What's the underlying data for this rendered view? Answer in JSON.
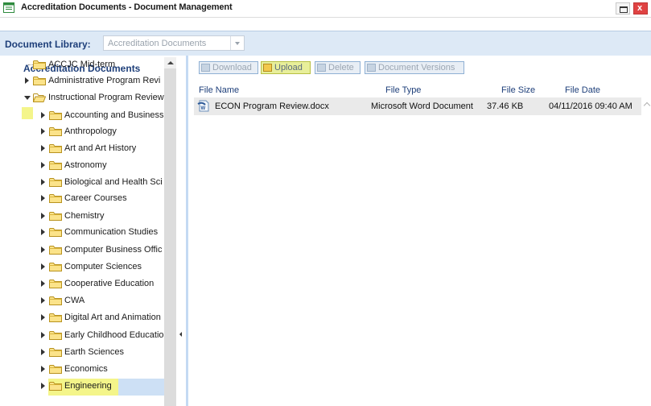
{
  "window": {
    "title": "Accreditation Documents - Document Management",
    "close_glyph": "x"
  },
  "library_bar": {
    "label": "Document Library:",
    "selected": "Accreditation Documents"
  },
  "tree": {
    "title": "Accreditation Documents",
    "items": [
      {
        "label": "ACCJC Mid-term",
        "expander": "none"
      },
      {
        "label": "Administrative Program Revi",
        "expander": "collapsed"
      },
      {
        "label": "Instructional Program Review",
        "expander": "expanded"
      },
      {
        "label": "Accounting and Business",
        "expander": "collapsed"
      },
      {
        "label": "Anthropology",
        "expander": "collapsed"
      },
      {
        "label": "Art and Art History",
        "expander": "collapsed"
      },
      {
        "label": "Astronomy",
        "expander": "collapsed"
      },
      {
        "label": "Biological and Health Sci",
        "expander": "collapsed"
      },
      {
        "label": "Career Courses",
        "expander": "collapsed"
      },
      {
        "label": "Chemistry",
        "expander": "collapsed"
      },
      {
        "label": "Communication Studies",
        "expander": "collapsed"
      },
      {
        "label": "Computer Business Offic",
        "expander": "collapsed"
      },
      {
        "label": "Computer Sciences",
        "expander": "collapsed"
      },
      {
        "label": "Cooperative Education",
        "expander": "collapsed"
      },
      {
        "label": "CWA",
        "expander": "collapsed"
      },
      {
        "label": "Digital Art and Animation",
        "expander": "collapsed"
      },
      {
        "label": "Early Childhood Educatio",
        "expander": "collapsed"
      },
      {
        "label": "Earth Sciences",
        "expander": "collapsed"
      },
      {
        "label": "Economics",
        "expander": "collapsed",
        "selected": true
      },
      {
        "label": "Engineering",
        "expander": "collapsed"
      }
    ]
  },
  "toolbar": {
    "download": "Download",
    "upload": "Upload",
    "delete": "Delete",
    "versions": "Document Versions"
  },
  "grid": {
    "columns": [
      "File Name",
      "File Type",
      "File Size",
      "File Date"
    ],
    "rows": [
      {
        "name": "ECON Program Review.docx",
        "type": "Microsoft Word Document",
        "size": "37.46 KB",
        "date": "04/11/2016 09:40 AM",
        "icon": "word-document-icon"
      }
    ]
  },
  "colors": {
    "highlight": "#f4f58a",
    "selection": "#cde0f5",
    "accent_text": "#1e3f7a",
    "library_bar_bg": "#dde9f6"
  }
}
